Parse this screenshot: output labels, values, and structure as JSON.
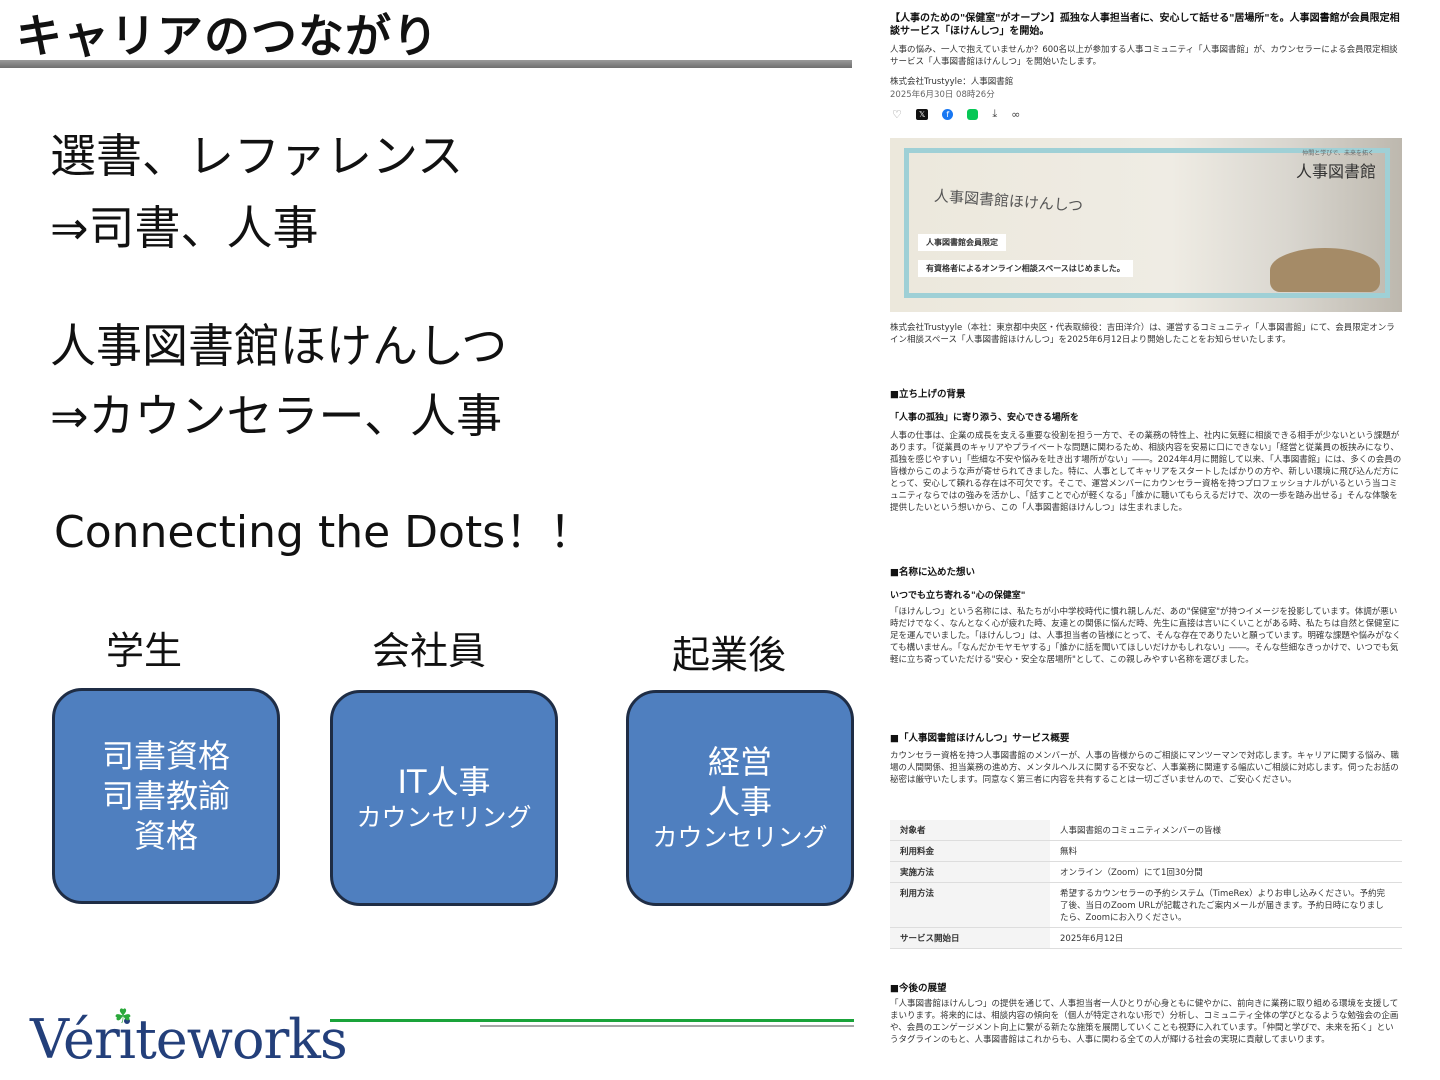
{
  "slide": {
    "title": "キャリアのつながり",
    "line1": "選書、レファレンス",
    "line2": "⇒司書、人事",
    "line3": "人事図書館ほけんしつ",
    "line4": "⇒カウンセラー、人事",
    "english": "Connecting the Dots！！",
    "stages": [
      {
        "label": "学生",
        "box": [
          "司書資格",
          "司書教諭",
          "資格"
        ]
      },
      {
        "label": "会社員",
        "box": [
          "IT人事",
          "カウンセリング"
        ]
      },
      {
        "label": "起業後",
        "box": [
          "経営",
          "人事",
          "カウンセリング"
        ]
      }
    ],
    "logo": "Vériteworks"
  },
  "article": {
    "headline": "【人事のための\"保健室\"がオープン】孤独な人事担当者に、安心して話せる\"居場所\"を。人事図書館が会員限定相談サービス「ほけんしつ」を開始。",
    "lead": "人事の悩み、一人で抱えていませんか？600名以上が参加する人事コミュニティ「人事図書館」が、カウンセラーによる会員限定相談サービス「人事図書館ほけんしつ」を開始いたします。",
    "company": "株式会社Trustyyle：人事図書館",
    "date": "2025年6月30日 08時26分",
    "banner": {
      "brand": "人事図書館",
      "brand_sub": "仲間と学びで、未来を拓く",
      "name": "人事図書館ほけんしつ",
      "tag1": "人事図書館会員限定",
      "tag2": "有資格者によるオンライン相談スペースはじめました。"
    },
    "intro": "株式会社Trustyyle（本社：東京都中央区・代表取締役：吉田洋介）は、運営するコミュニティ「人事図書館」にて、会員限定オンライン相談スペース「人事図書館ほけんしつ」を2025年6月12日より開始したことをお知らせいたします。",
    "sec1_title": "■立ち上げの背景",
    "sec1_sub": "「人事の孤独」に寄り添う、安心できる場所を",
    "sec1_body": "人事の仕事は、企業の成長を支える重要な役割を担う一方で、その業務の特性上、社内に気軽に相談できる相手が少ないという課題があります。「従業員のキャリアやプライベートな問題に関わるため、相談内容を安易に口にできない」「経営と従業員の板挟みになり、孤独を感じやすい」「些細な不安や悩みを吐き出す場所がない」――。2024年4月に開館して以来、「人事図書館」には、多くの会員の皆様からこのような声が寄せられてきました。特に、人事としてキャリアをスタートしたばかりの方や、新しい環境に飛び込んだ方にとって、安心して頼れる存在は不可欠です。そこで、運営メンバーにカウンセラー資格を持つプロフェッショナルがいるという当コミュニティならではの強みを活かし、「話すことで心が軽くなる」「誰かに聴いてもらえるだけで、次の一歩を踏み出せる」そんな体験を提供したいという想いから、この「人事図書館ほけんしつ」は生まれました。",
    "sec2_title": "■名称に込めた想い",
    "sec2_sub": "いつでも立ち寄れる\"心の保健室\"",
    "sec2_body": "「ほけんしつ」という名称には、私たちが小中学校時代に慣れ親しんだ、あの\"保健室\"が持つイメージを投影しています。体調が悪い時だけでなく、なんとなく心が疲れた時、友達との関係に悩んだ時、先生に直接は言いにくいことがある時、私たちは自然と保健室に足を運んでいました。「ほけんしつ」は、人事担当者の皆様にとって、そんな存在でありたいと願っています。明確な課題や悩みがなくても構いません。「なんだかモヤモヤする」「誰かに話を聞いてほしいだけかもしれない」――。そんな些細なきっかけで、いつでも気軽に立ち寄っていただける\"安心・安全な居場所\"として、この親しみやすい名称を選びました。",
    "sec3_title": "■「人事図書館ほけんしつ」サービス概要",
    "sec3_body": "カウンセラー資格を持つ人事図書館のメンバーが、人事の皆様からのご相談にマンツーマンで対応します。キャリアに関する悩み、職場の人間関係、担当業務の進め方、メンタルヘルスに関する不安など、人事業務に関連する幅広いご相談に対応します。伺ったお話の秘密は厳守いたします。同意なく第三者に内容を共有することは一切ございませんので、ご安心ください。",
    "table": [
      {
        "k": "対象者",
        "v": "人事図書館のコミュニティメンバーの皆様"
      },
      {
        "k": "利用料金",
        "v": "無料"
      },
      {
        "k": "実施方法",
        "v": "オンライン（Zoom）にて1回30分間"
      },
      {
        "k": "利用方法",
        "v": "希望するカウンセラーの予約システム（TimeRex）よりお申し込みください。予約完了後、当日のZoom URLが記載されたご案内メールが届きます。予約日時になりましたら、Zoomにお入りください。"
      },
      {
        "k": "サービス開始日",
        "v": "2025年6月12日"
      }
    ],
    "sec4_title": "■今後の展望",
    "sec4_body": "「人事図書館ほけんしつ」の提供を通じて、人事担当者一人ひとりが心身ともに健やかに、前向きに業務に取り組める環境を支援してまいります。将来的には、相談内容の傾向を（個人が特定されない形で）分析し、コミュニティ全体の学びとなるような勉強会の企画や、会員のエンゲージメント向上に繋がる新たな施策を展開していくことも視野に入れています。「仲間と学びで、未来を拓く」というタグラインのもと、人事図書館はこれからも、人事に関わる全ての人が輝ける社会の実現に貢献してまいります。"
  }
}
